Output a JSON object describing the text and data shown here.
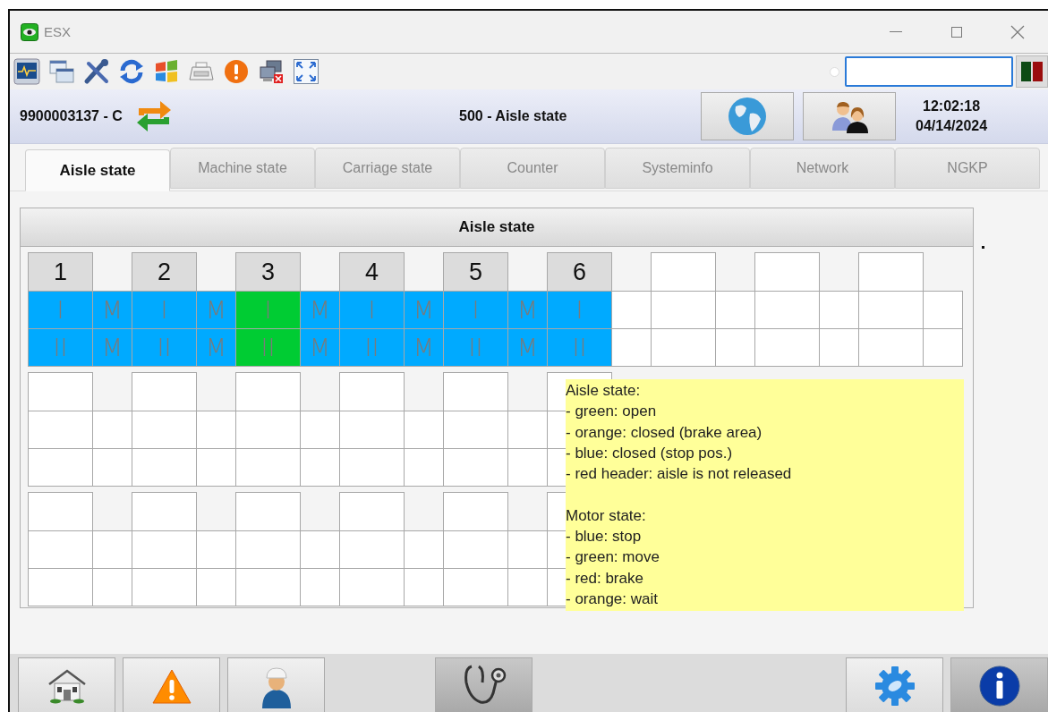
{
  "window": {
    "title": "ESX"
  },
  "header": {
    "machine": "9900003137 - C",
    "title": "500 - Aisle state",
    "time": "12:02:18",
    "date": "04/14/2024"
  },
  "tabs": [
    {
      "label": "Aisle state",
      "selected": true
    },
    {
      "label": "Machine state",
      "selected": false
    },
    {
      "label": "Carriage state",
      "selected": false
    },
    {
      "label": "Counter",
      "selected": false
    },
    {
      "label": "Systeminfo",
      "selected": false
    },
    {
      "label": "Network",
      "selected": false
    },
    {
      "label": "NGKP",
      "selected": false
    }
  ],
  "panel": {
    "title": "Aisle state"
  },
  "aisles": [
    {
      "label": "1",
      "color": "#00aaff",
      "tracks": [
        "I",
        "II"
      ],
      "motor": {
        "color": "#00aaff",
        "tracks": [
          "M",
          "M"
        ]
      }
    },
    {
      "label": "2",
      "color": "#00aaff",
      "tracks": [
        "I",
        "II"
      ],
      "motor": {
        "color": "#00aaff",
        "tracks": [
          "M",
          "M"
        ]
      }
    },
    {
      "label": "3",
      "color": "#00cc33",
      "tracks": [
        "I",
        "II"
      ],
      "motor": {
        "color": "#00aaff",
        "tracks": [
          "M",
          "M"
        ]
      }
    },
    {
      "label": "4",
      "color": "#00aaff",
      "tracks": [
        "I",
        "II"
      ],
      "motor": {
        "color": "#00aaff",
        "tracks": [
          "M",
          "M"
        ]
      }
    },
    {
      "label": "5",
      "color": "#00aaff",
      "tracks": [
        "I",
        "II"
      ],
      "motor": {
        "color": "#00aaff",
        "tracks": [
          "M",
          "M"
        ]
      }
    },
    {
      "label": "6",
      "color": "#00aaff",
      "tracks": [
        "I",
        "II"
      ]
    }
  ],
  "tooltip": {
    "sections": [
      {
        "title": "Aisle state:",
        "lines": [
          "- green: open",
          "- orange: closed (brake area)",
          "- blue: closed (stop pos.)",
          "- red header: aisle is not released"
        ]
      },
      {
        "title": "Motor state:",
        "lines": [
          "- blue: stop",
          "- green: move",
          "- red: brake",
          "- orange: wait"
        ]
      }
    ]
  },
  "footer": {
    "left": [
      {
        "kind": "home",
        "selected": false
      },
      {
        "kind": "warning",
        "selected": false
      },
      {
        "kind": "worker",
        "selected": false
      }
    ],
    "center": [
      {
        "kind": "stethoscope",
        "selected": true
      }
    ],
    "right": [
      {
        "kind": "settings",
        "selected": false
      },
      {
        "kind": "info",
        "selected": true
      }
    ]
  }
}
